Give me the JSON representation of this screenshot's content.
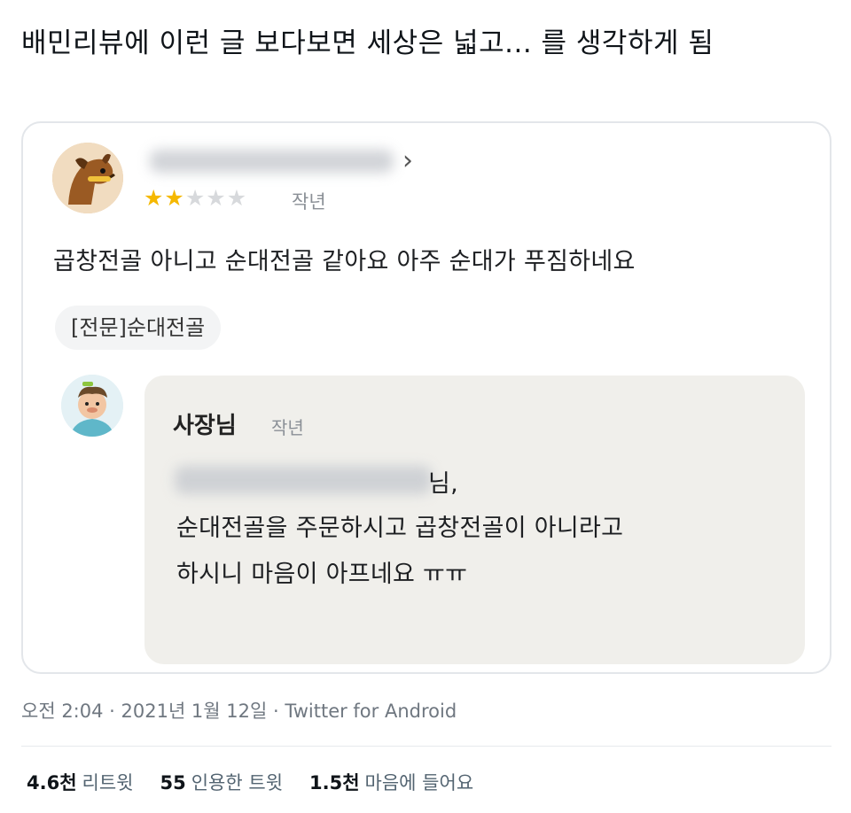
{
  "tweet": {
    "text": "배민리뷰에 이런 글 보다보면 세상은 넓고... 를 생각하게 됨",
    "meta": "오전 2:04 · 2021년 1월 12일 · Twitter for Android",
    "stats": [
      {
        "count": "4.6천",
        "label": "리트윗"
      },
      {
        "count": "55",
        "label": "인용한 트윗"
      },
      {
        "count": "1.5천",
        "label": "마음에 들어요"
      }
    ]
  },
  "review": {
    "rating": 2,
    "max_rating": 5,
    "time": "작년",
    "text": "곱창전골 아니고 순대전골 같아요 아주 순대가 푸짐하네요",
    "menu_tag": "[전문]순대전골",
    "star_on_color": "#f5b800",
    "star_off_color": "#d7d9dc"
  },
  "reply": {
    "author": "사장님",
    "time": "작년",
    "line1_suffix": "님,",
    "line2": "순대전골을 주문하시고 곱창전골이 아니라고",
    "line3": "하시니 마음이 아프네요 ㅠㅠ"
  },
  "icons": {
    "chevron": "›",
    "star": "★"
  }
}
